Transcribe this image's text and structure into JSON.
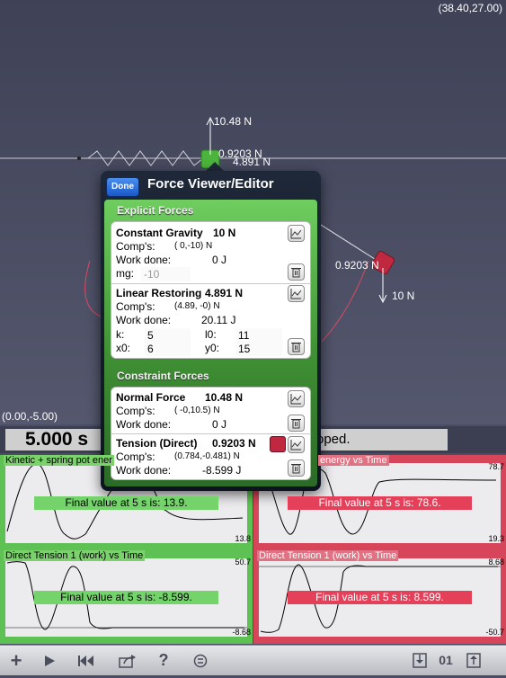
{
  "canvas": {
    "top_right_coord": "(38.40,27.00)",
    "bottom_left_coord": "(0.00,-5.00)",
    "force_labels": {
      "normal_up": "10.48 N",
      "tension_left": "0.9203 N",
      "spring": "4.891 N",
      "tension_right": "0.9203 N",
      "gravity_right": "10 N"
    }
  },
  "status": {
    "time": "5.000 s",
    "message": "oped."
  },
  "popover": {
    "done_label": "Done",
    "title": "Force Viewer/Editor",
    "explicit_header": "Explicit Forces",
    "constraint_header": "Constraint Forces",
    "gravity": {
      "name": "Constant Gravity",
      "magnitude": "10 N",
      "comps_label": "Comp's:",
      "comps": "( 0,-10) N",
      "work_label": "Work done:",
      "work": "0 J",
      "mg_label": "mg:",
      "mg": "-10"
    },
    "restoring": {
      "name": "Linear Restoring",
      "magnitude": "4.891 N",
      "comps_label": "Comp's:",
      "comps": "(4.89, -0) N",
      "work_label": "Work done:",
      "work": "20.11 J",
      "k_label": "k:",
      "k": "5",
      "l0_label": "l0:",
      "l0": "11",
      "x0_label": "x0:",
      "x0": "6",
      "y0_label": "y0:",
      "y0": "15"
    },
    "normal": {
      "name": "Normal Force",
      "magnitude": "10.48 N",
      "comps_label": "Comp's:",
      "comps": "( -0,10.5) N",
      "work_label": "Work done:",
      "work": "0 J"
    },
    "tension": {
      "name": "Tension (Direct)",
      "magnitude": "0.9203 N",
      "comps_label": "Comp's:",
      "comps": "(0.784,-0.481) N",
      "work_label": "Work done:",
      "work": "-8.599 J",
      "swatch_color": "#c0283f"
    }
  },
  "graphs": [
    {
      "title": "Kinetic + spring pot ener",
      "final": "Final value at 5 s is: 13.9.",
      "max": "",
      "min": "13.8",
      "color": "green"
    },
    {
      "title": "energy vs Time",
      "final": "Final value at 5 s is: 78.6.",
      "max": "78.7",
      "min": "19.3",
      "color": "red"
    },
    {
      "title": "Direct Tension 1 (work) vs Time",
      "final": "Final value at 5 s is: -8.599.",
      "max": "50.7",
      "min": "-8.68",
      "color": "green"
    },
    {
      "title": "Direct Tension 1 (work) vs Time",
      "final": "Final value at 5 s is: 8.599.",
      "max": "8.68",
      "min": "-50.7",
      "color": "red"
    }
  ],
  "toolbar": {
    "frame_counter": "01",
    "icons": [
      "plus-icon",
      "play-icon",
      "rewind-icon",
      "share-icon",
      "help-icon",
      "menu-icon",
      "download-icon",
      "upload-icon"
    ]
  },
  "colors": {
    "accent_green": "#5ec154",
    "accent_red": "#d7455a",
    "block_green": "#4bb43c",
    "block_red": "#c0283f"
  }
}
